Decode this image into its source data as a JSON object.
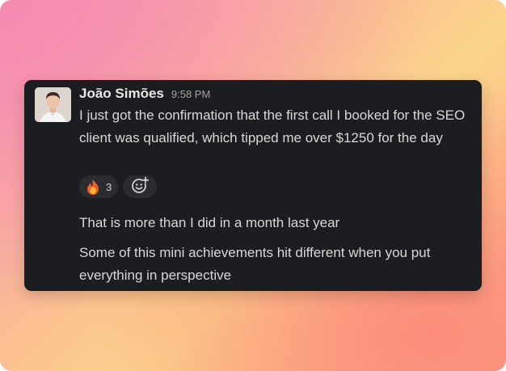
{
  "message": {
    "author": "João Simões",
    "time": "9:58 PM",
    "lines": [
      "I just got the confirmation that the first call I booked for the SEO client was qualified, which tipped me over $1250 for the day",
      "That is more than I did in a month last year",
      "Some of this mini achievements hit different when you put everything in perspective"
    ],
    "reactions": [
      {
        "emoji": "fire-icon",
        "count": "3"
      }
    ],
    "add_reaction_icon": "add-emoji-icon"
  },
  "colors": {
    "card_bg": "#1b1d21",
    "text": "#d8d8d8",
    "author": "#e8e8e8",
    "timestamp": "#a3a3a3",
    "reaction_bg": "#2a2c30"
  }
}
